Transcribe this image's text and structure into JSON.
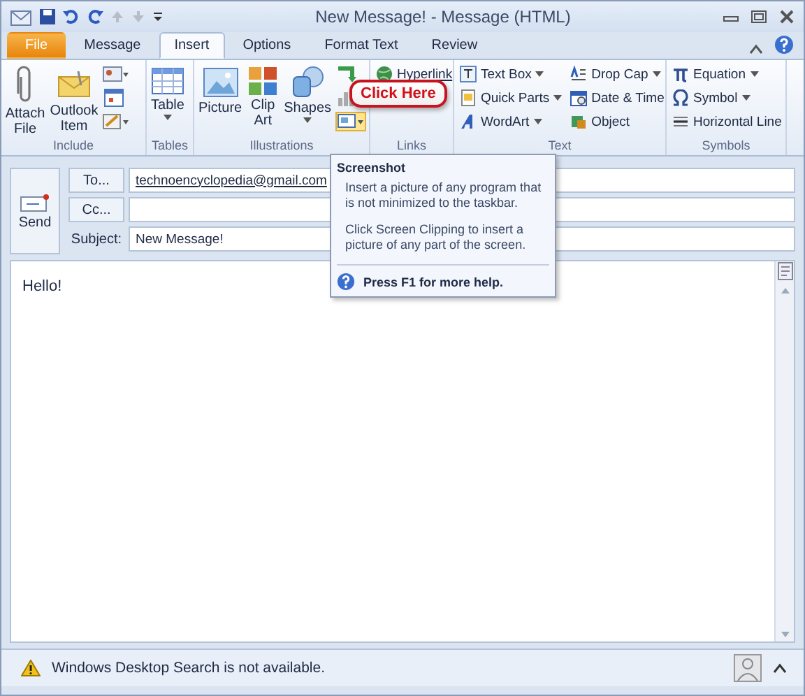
{
  "window": {
    "title": "New Message! - Message (HTML)"
  },
  "tabs": [
    {
      "label": "File",
      "kind": "file",
      "selected": false
    },
    {
      "label": "Message",
      "kind": "tab",
      "selected": false
    },
    {
      "label": "Insert",
      "kind": "tab",
      "selected": true
    },
    {
      "label": "Options",
      "kind": "tab",
      "selected": false
    },
    {
      "label": "Format Text",
      "kind": "tab",
      "selected": false
    },
    {
      "label": "Review",
      "kind": "tab",
      "selected": false
    }
  ],
  "ribbon": {
    "include": {
      "label": "Include",
      "buttons": [
        "Attach File",
        "Outlook Item"
      ]
    },
    "tables": {
      "label": "Tables",
      "buttons": [
        "Table"
      ]
    },
    "illustrations": {
      "label": "Illustrations",
      "buttons": [
        "Picture",
        "Clip Art",
        "Shapes"
      ],
      "screenshot_highlighted": true
    },
    "links": {
      "label": "Links",
      "buttons": [
        "Hyperlink"
      ]
    },
    "text": {
      "label": "Text",
      "buttons": [
        "Text Box",
        "Quick Parts",
        "WordArt",
        "Drop Cap",
        "Date & Time",
        "Object"
      ]
    },
    "symbols": {
      "label": "Symbols",
      "buttons": [
        "Equation",
        "Symbol",
        "Horizontal Line"
      ]
    }
  },
  "callout": {
    "text": "Click Here"
  },
  "header": {
    "send": "Send",
    "to": {
      "button": "To...",
      "value": "technoencyclopedia@gmail.com"
    },
    "cc": {
      "button": "Cc..."
    },
    "subject": {
      "label": "Subject:",
      "value": "New Message!"
    }
  },
  "body": {
    "text": "Hello!"
  },
  "tooltip": {
    "title": "Screenshot",
    "paragraphs": [
      "Insert a picture of any program that is not minimized to the taskbar.",
      "Click Screen Clipping to insert a picture of any part of the screen."
    ],
    "help": "Press F1 for more help."
  },
  "status_bar": {
    "text": "Windows Desktop Search is not available."
  }
}
